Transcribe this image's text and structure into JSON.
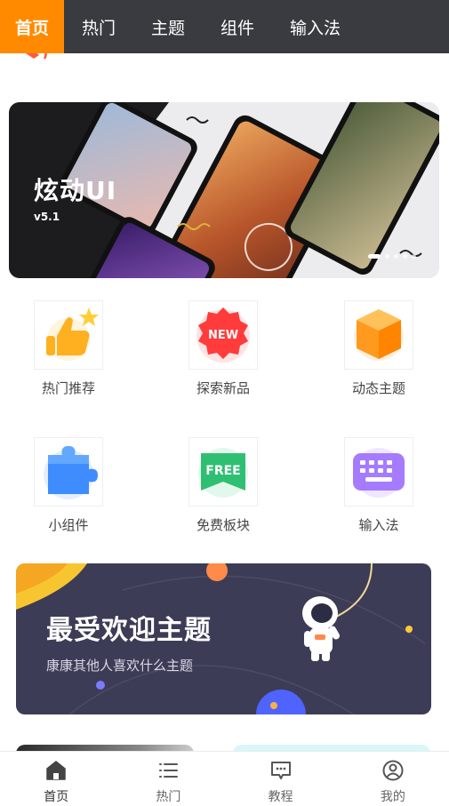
{
  "top_tabs": [
    {
      "label": "首页",
      "active": true
    },
    {
      "label": "热门",
      "active": false
    },
    {
      "label": "主题",
      "active": false
    },
    {
      "label": "组件",
      "active": false
    },
    {
      "label": "输入法",
      "active": false
    }
  ],
  "banner": {
    "brand": "炫动UI",
    "version": "v5.1",
    "slide_count": 5,
    "active_slide": 1
  },
  "categories": [
    {
      "label": "热门推荐",
      "icon": "thumbs-up-star-icon",
      "color": "#ffb020"
    },
    {
      "label": "探索新品",
      "icon": "new-badge-icon",
      "color": "#ff3b3b"
    },
    {
      "label": "动态主题",
      "icon": "cube-icon",
      "color": "#ff9a1f"
    },
    {
      "label": "小组件",
      "icon": "puzzle-icon",
      "color": "#3f8cff"
    },
    {
      "label": "免费板块",
      "icon": "free-ribbon-icon",
      "color": "#2fbf73"
    },
    {
      "label": "输入法",
      "icon": "keyboard-icon",
      "color": "#a57bff"
    }
  ],
  "promo": {
    "title": "最受欢迎主题",
    "subtitle": "康康其他人喜欢什么主题"
  },
  "bottom_nav": [
    {
      "label": "首页",
      "icon": "home-icon",
      "active": true
    },
    {
      "label": "热门",
      "icon": "list-icon",
      "active": false
    },
    {
      "label": "教程",
      "icon": "chat-bubble-icon",
      "active": false
    },
    {
      "label": "我的",
      "icon": "user-circle-icon",
      "active": false
    }
  ],
  "colors": {
    "accent": "#ff8a00",
    "topbar": "#3a3b40",
    "promo_bg": "#3d3c56"
  }
}
